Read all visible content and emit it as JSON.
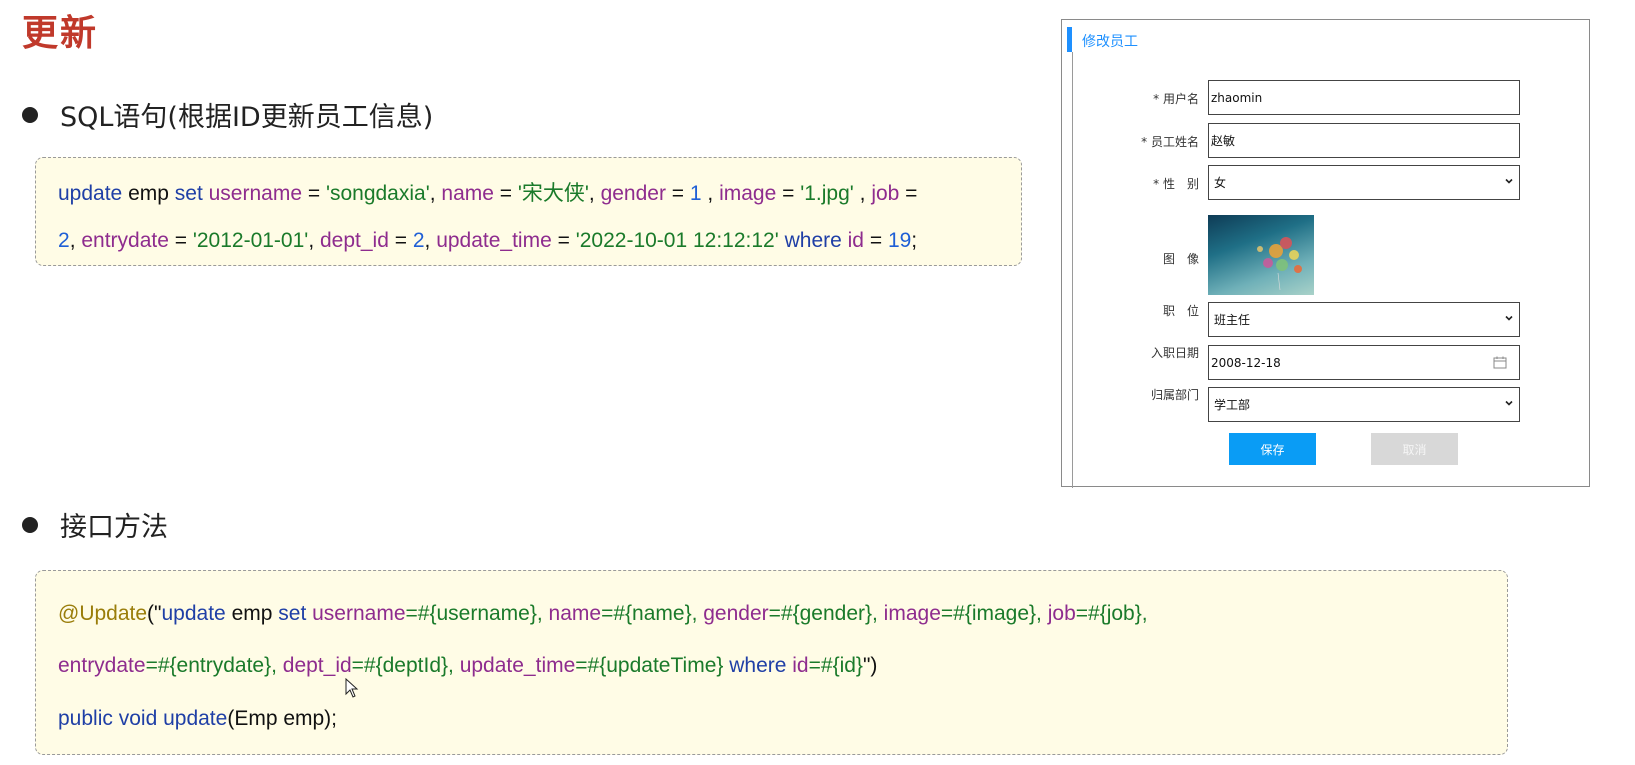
{
  "title": "更新",
  "sections": {
    "sql": {
      "heading": "SQL语句(根据ID更新员工信息)"
    },
    "iface": {
      "heading": "接口方法"
    }
  },
  "sql_code": {
    "line1": [
      {
        "t": "update",
        "c": "kw"
      },
      {
        "t": " emp ",
        "c": "pl"
      },
      {
        "t": "set",
        "c": "kw"
      },
      {
        "t": " ",
        "c": "pl"
      },
      {
        "t": "username",
        "c": "pu"
      },
      {
        "t": " = ",
        "c": "pl"
      },
      {
        "t": "'songdaxia'",
        "c": "st"
      },
      {
        "t": ", ",
        "c": "pl"
      },
      {
        "t": "name",
        "c": "pu"
      },
      {
        "t": " = ",
        "c": "pl"
      },
      {
        "t": "'宋大侠'",
        "c": "st"
      },
      {
        "t": ", ",
        "c": "pl"
      },
      {
        "t": "gender",
        "c": "pu"
      },
      {
        "t": " = ",
        "c": "pl"
      },
      {
        "t": "1",
        "c": "nu"
      },
      {
        "t": " , ",
        "c": "pl"
      },
      {
        "t": "image",
        "c": "pu"
      },
      {
        "t": " = ",
        "c": "pl"
      },
      {
        "t": "'1.jpg'",
        "c": "st"
      },
      {
        "t": " , ",
        "c": "pl"
      },
      {
        "t": "job",
        "c": "pu"
      },
      {
        "t": " =",
        "c": "pl"
      }
    ],
    "line2": [
      {
        "t": "2",
        "c": "nu"
      },
      {
        "t": ", ",
        "c": "pl"
      },
      {
        "t": "entrydate",
        "c": "pu"
      },
      {
        "t": " = ",
        "c": "pl"
      },
      {
        "t": "'2012-01-01'",
        "c": "st"
      },
      {
        "t": ", ",
        "c": "pl"
      },
      {
        "t": "dept_id",
        "c": "pu"
      },
      {
        "t": " = ",
        "c": "pl"
      },
      {
        "t": "2",
        "c": "nu"
      },
      {
        "t": ", ",
        "c": "pl"
      },
      {
        "t": "update_time",
        "c": "pu"
      },
      {
        "t": " = ",
        "c": "pl"
      },
      {
        "t": "'2022-10-01 12:12:12'",
        "c": "st"
      },
      {
        "t": " ",
        "c": "pl"
      },
      {
        "t": "where",
        "c": "kw"
      },
      {
        "t": " ",
        "c": "pl"
      },
      {
        "t": "id",
        "c": "pu"
      },
      {
        "t": " = ",
        "c": "pl"
      },
      {
        "t": "19",
        "c": "nu"
      },
      {
        "t": ";",
        "c": "pl"
      }
    ]
  },
  "iface_code": {
    "line1": [
      {
        "t": "@Update",
        "c": "an"
      },
      {
        "t": "(\"",
        "c": "pl"
      },
      {
        "t": "update",
        "c": "kw"
      },
      {
        "t": " emp ",
        "c": "pl"
      },
      {
        "t": "set",
        "c": "kw"
      },
      {
        "t": " ",
        "c": "pl"
      },
      {
        "t": "username",
        "c": "pu"
      },
      {
        "t": "=#{username}, ",
        "c": "gr"
      },
      {
        "t": "name",
        "c": "pu"
      },
      {
        "t": "=#{name}, ",
        "c": "gr"
      },
      {
        "t": "gender",
        "c": "pu"
      },
      {
        "t": "=#{gender}, ",
        "c": "gr"
      },
      {
        "t": "image",
        "c": "pu"
      },
      {
        "t": "=#{image}, ",
        "c": "gr"
      },
      {
        "t": "job",
        "c": "pu"
      },
      {
        "t": "=#{job},",
        "c": "gr"
      }
    ],
    "line2": [
      {
        "t": "entrydate",
        "c": "pu"
      },
      {
        "t": "=#{entrydate}, ",
        "c": "gr"
      },
      {
        "t": "dept_id",
        "c": "pu"
      },
      {
        "t": "=#{deptId}, ",
        "c": "gr"
      },
      {
        "t": "update_time",
        "c": "pu"
      },
      {
        "t": "=#{updateTime} ",
        "c": "gr"
      },
      {
        "t": "where",
        "c": "kw"
      },
      {
        "t": " ",
        "c": "pl"
      },
      {
        "t": "id",
        "c": "pu"
      },
      {
        "t": "=#{id}",
        "c": "gr"
      },
      {
        "t": "\")",
        "c": "pl"
      }
    ],
    "line3": [
      {
        "t": "public",
        "c": "kw"
      },
      {
        "t": " ",
        "c": "pl"
      },
      {
        "t": "void",
        "c": "kw"
      },
      {
        "t": " ",
        "c": "pl"
      },
      {
        "t": "update",
        "c": "kw"
      },
      {
        "t": "(Emp emp);",
        "c": "pl"
      }
    ]
  },
  "form": {
    "title": "修改员工",
    "fields": {
      "username": {
        "label": "* 用户名",
        "value": "zhaomin"
      },
      "name": {
        "label": "* 员工姓名",
        "value": "赵敏"
      },
      "gender": {
        "label": "* 性　别",
        "value": "女"
      },
      "image": {
        "label": "图　像"
      },
      "job": {
        "label": "职　位",
        "value": "班主任"
      },
      "entrydate": {
        "label": "入职日期",
        "value": "2008-12-18"
      },
      "dept": {
        "label": "归属部门",
        "value": "学工部"
      }
    },
    "save_label": "保存",
    "cancel_label": "取消"
  },
  "colors": {
    "title": "#c0392b",
    "keyword": "#1f3fa6",
    "column": "#8e2c8e",
    "string": "#1a7a2a",
    "number": "#1f5fd6",
    "annotation": "#9a7d0a",
    "accent": "#1e90ff",
    "save_button": "#0a9cf5",
    "code_bg": "#fffce6"
  },
  "icons": [
    "chevron-down-icon",
    "calendar-icon",
    "mouse-cursor-icon"
  ]
}
